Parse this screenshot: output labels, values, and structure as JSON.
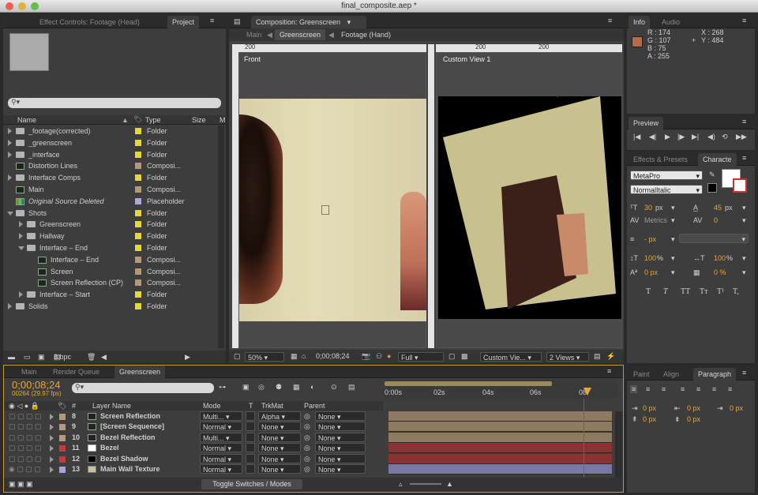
{
  "window": {
    "title": "final_composite.aep *"
  },
  "project_panel": {
    "tabs": [
      "Effect Controls: Footage (Head)",
      "Project"
    ],
    "columns": {
      "name": "Name",
      "type": "Type",
      "size": "Size",
      "m": "M"
    },
    "items": [
      {
        "name": "_footage(corrected)",
        "type": "Folder",
        "kind": "folder",
        "indent": 0,
        "expand": "right",
        "color": "#e5d640",
        "italic": false
      },
      {
        "name": "_greenscreen",
        "type": "Folder",
        "kind": "folder",
        "indent": 0,
        "expand": "right",
        "color": "#e5d640",
        "italic": false
      },
      {
        "name": "_interface",
        "type": "Folder",
        "kind": "folder",
        "indent": 0,
        "expand": "right",
        "color": "#e5d640",
        "italic": false
      },
      {
        "name": "Distortion Lines",
        "type": "Composi...",
        "kind": "comp",
        "indent": 0,
        "expand": "none",
        "color": "#b49a78",
        "italic": false
      },
      {
        "name": "Interface Comps",
        "type": "Folder",
        "kind": "folder",
        "indent": 0,
        "expand": "right",
        "color": "#e5d640",
        "italic": false
      },
      {
        "name": "Main",
        "type": "Composi...",
        "kind": "comp",
        "indent": 0,
        "expand": "none",
        "color": "#b49a78",
        "italic": false
      },
      {
        "name": "Original Source Deleted",
        "type": "Placeholder",
        "kind": "placeholder",
        "indent": 0,
        "expand": "none",
        "color": "#b0a8d8",
        "italic": true
      },
      {
        "name": "Shots",
        "type": "Folder",
        "kind": "folder",
        "indent": 0,
        "expand": "down",
        "color": "#e5d640",
        "italic": false
      },
      {
        "name": "Greenscreen",
        "type": "Folder",
        "kind": "folder",
        "indent": 1,
        "expand": "right",
        "color": "#e5d640",
        "italic": false
      },
      {
        "name": "Hallway",
        "type": "Folder",
        "kind": "folder",
        "indent": 1,
        "expand": "right",
        "color": "#e5d640",
        "italic": false
      },
      {
        "name": "Interface – End",
        "type": "Folder",
        "kind": "folder",
        "indent": 1,
        "expand": "down",
        "color": "#e5d640",
        "italic": false
      },
      {
        "name": "Interface – End",
        "type": "Composi...",
        "kind": "comp",
        "indent": 2,
        "expand": "none",
        "color": "#b49a78",
        "italic": false
      },
      {
        "name": "Screen",
        "type": "Composi...",
        "kind": "comp",
        "indent": 2,
        "expand": "none",
        "color": "#b49a78",
        "italic": false
      },
      {
        "name": "Screen Reflection (CP)",
        "type": "Composi...",
        "kind": "comp",
        "indent": 2,
        "expand": "none",
        "color": "#b49a78",
        "italic": false
      },
      {
        "name": "Interface – Start",
        "type": "Folder",
        "kind": "folder",
        "indent": 1,
        "expand": "right",
        "color": "#e5d640",
        "italic": false
      },
      {
        "name": "Solids",
        "type": "Folder",
        "kind": "folder",
        "indent": 0,
        "expand": "right",
        "color": "#e5d640",
        "italic": false
      }
    ],
    "bpc": "8 bpc"
  },
  "composition_panel": {
    "tab": "Composition: Greenscreen",
    "nav": [
      "Main",
      "Greenscreen",
      "Footage (Hand)"
    ],
    "views": [
      "Front",
      "Custom View 1"
    ],
    "ruler_top": "200",
    "ruler_top2": "200",
    "ruler_top3": "200",
    "zoom": "50%",
    "timecode": "0;00;08;24",
    "resolution": "Full",
    "view_select": "Custom Vie...",
    "views_count": "2 Views"
  },
  "info_panel": {
    "tabs": [
      "Info",
      "Audio"
    ],
    "swatch": "#b46b4b",
    "r": "R : 174",
    "g": "G : 107",
    "b": "B : 75",
    "a": "A : 255",
    "x": "X : 268",
    "y": "Y : 484"
  },
  "preview_panel": {
    "tab": "Preview"
  },
  "character_panel": {
    "tabs": [
      "Effects & Presets",
      "Characte"
    ],
    "font": "MetaPro",
    "style": "NormalItalic",
    "size": "30",
    "size_unit": "px",
    "leading": "45",
    "leading_unit": "px",
    "kerning": "Metrics",
    "tracking": "0",
    "stroke": "- px",
    "vscale": "100",
    "vscale_unit": "%",
    "hscale": "100",
    "hscale_unit": "%",
    "baseline": "0 px",
    "tsume": "0 %",
    "styles": [
      "T",
      "T",
      "TT",
      "Tт",
      "T¹",
      "T,"
    ]
  },
  "paragraph_panel": {
    "tabs": [
      "Paint",
      "Align",
      "Paragraph"
    ],
    "indent_left": "0 px",
    "indent_first": "0 px",
    "indent_right": "0 px",
    "space_before": "0 px",
    "space_after": "0 px"
  },
  "timeline": {
    "tabs": [
      "Main",
      "Render Queue",
      "Greenscreen"
    ],
    "timecode": "0;00;08;24",
    "frame_info": "00264 (29.97 fps)",
    "columns": {
      "num": "#",
      "layer_name": "Layer Name",
      "mode": "Mode",
      "t": "T",
      "trkmat": "TrkMat",
      "parent": "Parent"
    },
    "ruler": [
      "0:00s",
      "02s",
      "04s",
      "06s",
      "08"
    ],
    "layers": [
      {
        "num": "8",
        "name": "Screen Reflection",
        "mode": "Multi...",
        "trkmat": "Alpha",
        "parent": "None",
        "label": "#b49a78",
        "bar": "#8e7a60",
        "icon": "comp"
      },
      {
        "num": "9",
        "name": "[Screen Sequence]",
        "mode": "Normal",
        "trkmat": "None",
        "parent": "None",
        "label": "#b49a78",
        "bar": "#8e7a60",
        "icon": "comp"
      },
      {
        "num": "10",
        "name": "Bezel Reflection",
        "mode": "Multi...",
        "trkmat": "None",
        "parent": "None",
        "label": "#b49a78",
        "bar": "#8e7a60",
        "icon": "comp"
      },
      {
        "num": "11",
        "name": "Bezel",
        "mode": "Normal",
        "trkmat": "None",
        "parent": "None",
        "label": "#c23c3c",
        "bar": "#8c3232",
        "icon": "white"
      },
      {
        "num": "12",
        "name": "Bezel Shadow",
        "mode": "Normal",
        "trkmat": "None",
        "parent": "None",
        "label": "#c23c3c",
        "bar": "#8c3232",
        "icon": "black"
      },
      {
        "num": "13",
        "name": "Main Wall Texture",
        "mode": "Normal",
        "trkmat": "None",
        "parent": "None",
        "label": "#a6a6d8",
        "bar": "#7878a8",
        "icon": "img"
      }
    ],
    "toggle_label": "Toggle Switches / Modes"
  }
}
